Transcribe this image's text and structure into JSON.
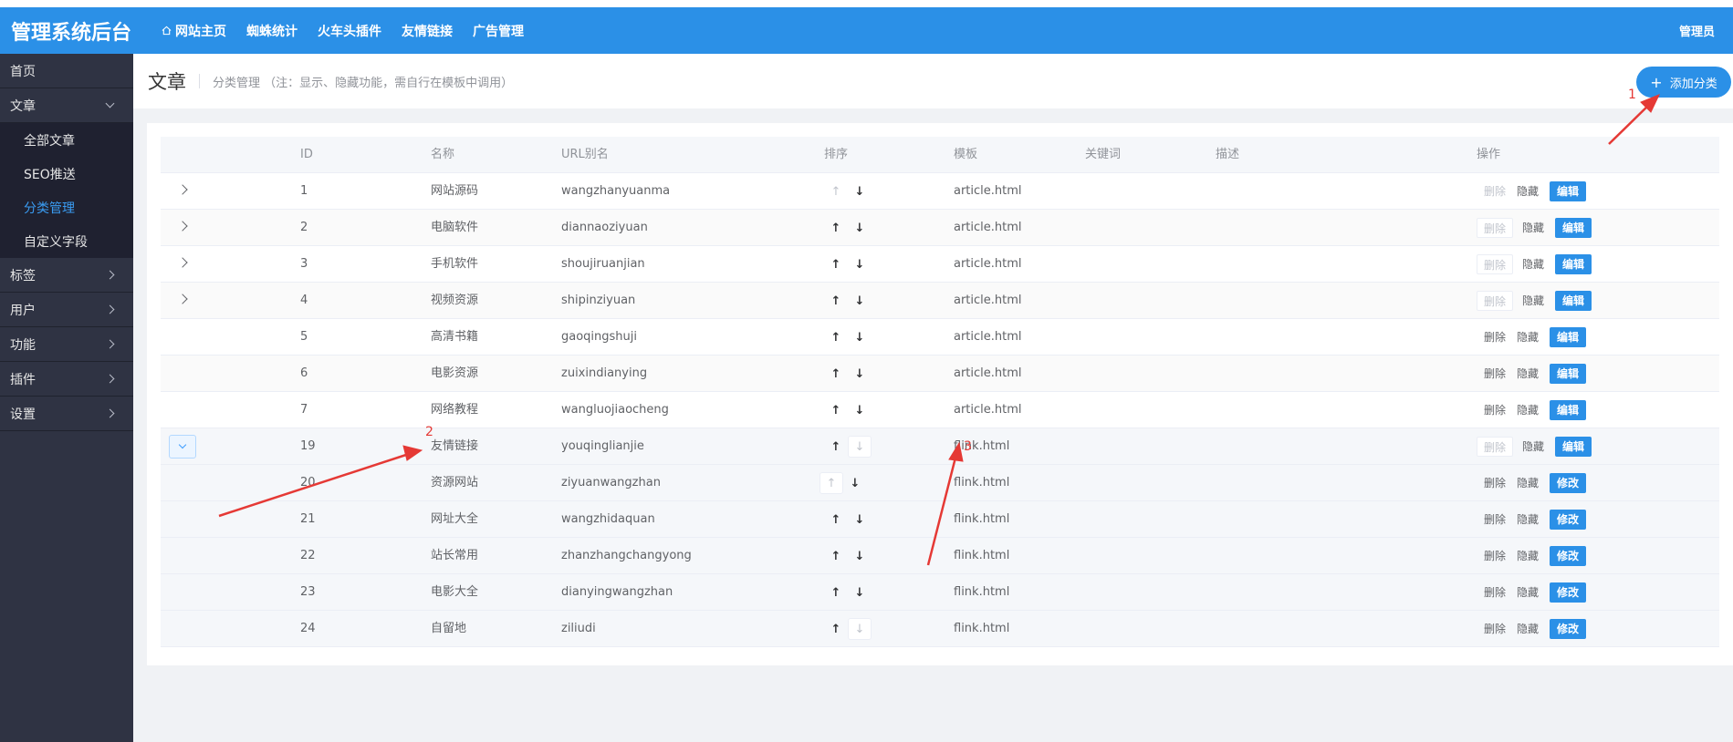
{
  "app": {
    "title": "管理系统后台",
    "user": "管理员"
  },
  "topnav": [
    {
      "label": "网站主页",
      "icon": "home-icon"
    },
    {
      "label": "蜘蛛统计"
    },
    {
      "label": "火车头插件"
    },
    {
      "label": "友情链接"
    },
    {
      "label": "广告管理"
    }
  ],
  "sidebar": {
    "home": "首页",
    "article": "文章",
    "article_sub": [
      "全部文章",
      "SEO推送",
      "分类管理",
      "自定义字段"
    ],
    "active_sub": "分类管理",
    "others": [
      "标签",
      "用户",
      "功能",
      "插件",
      "设置"
    ]
  },
  "page": {
    "title": "文章",
    "desc": "分类管理 （注：显示、隐藏功能，需自行在模板中调用）",
    "add_button": "添加分类"
  },
  "table": {
    "headers": {
      "id": "ID",
      "name": "名称",
      "url": "URL别名",
      "sort": "排序",
      "template": "模板",
      "keywords": "关键词",
      "description": "描述",
      "ops": "操作"
    },
    "rows": [
      {
        "id": "1",
        "name": "网站源码",
        "url": "wangzhanyuanma",
        "template": "article.html",
        "expand": "collapsed",
        "child": false,
        "edit": "编辑"
      },
      {
        "id": "2",
        "name": "电脑软件",
        "url": "diannaoziyuan",
        "template": "article.html",
        "expand": "collapsed",
        "child": false,
        "edit": "编辑"
      },
      {
        "id": "3",
        "name": "手机软件",
        "url": "shoujiruanjian",
        "template": "article.html",
        "expand": "collapsed",
        "child": false,
        "edit": "编辑"
      },
      {
        "id": "4",
        "name": "视频资源",
        "url": "shipinziyuan",
        "template": "article.html",
        "expand": "collapsed",
        "child": false,
        "edit": "编辑"
      },
      {
        "id": "5",
        "name": "高清书籍",
        "url": "gaoqingshuji",
        "template": "article.html",
        "expand": "none",
        "child": false,
        "edit": "编辑"
      },
      {
        "id": "6",
        "name": "电影资源",
        "url": "zuixindianying",
        "template": "article.html",
        "expand": "none",
        "child": false,
        "edit": "编辑"
      },
      {
        "id": "7",
        "name": "网络教程",
        "url": "wangluojiaocheng",
        "template": "article.html",
        "expand": "none",
        "child": false,
        "edit": "编辑"
      },
      {
        "id": "19",
        "name": "友情链接",
        "url": "youqinglianjie",
        "template": "flink.html",
        "expand": "expanded",
        "child": false,
        "edit": "编辑"
      },
      {
        "id": "20",
        "name": "资源网站",
        "url": "ziyuanwangzhan",
        "template": "flink.html",
        "expand": "none",
        "child": true,
        "edit": "修改"
      },
      {
        "id": "21",
        "name": "网址大全",
        "url": "wangzhidaquan",
        "template": "flink.html",
        "expand": "none",
        "child": true,
        "edit": "修改"
      },
      {
        "id": "22",
        "name": "站长常用",
        "url": "zhanzhangchangyong",
        "template": "flink.html",
        "expand": "none",
        "child": true,
        "edit": "修改"
      },
      {
        "id": "23",
        "name": "电影大全",
        "url": "dianyingwangzhan",
        "template": "flink.html",
        "expand": "none",
        "child": true,
        "edit": "修改"
      },
      {
        "id": "24",
        "name": "自留地",
        "url": "ziliudi",
        "template": "flink.html",
        "expand": "none",
        "child": true,
        "edit": "修改"
      }
    ],
    "op_labels": {
      "delete": "删除",
      "hide": "隐藏"
    }
  },
  "annotations": [
    "1",
    "2",
    "3"
  ],
  "colors": {
    "primary": "#2b90e7",
    "sidebar": "#2f3343",
    "annotation": "#e53935"
  }
}
